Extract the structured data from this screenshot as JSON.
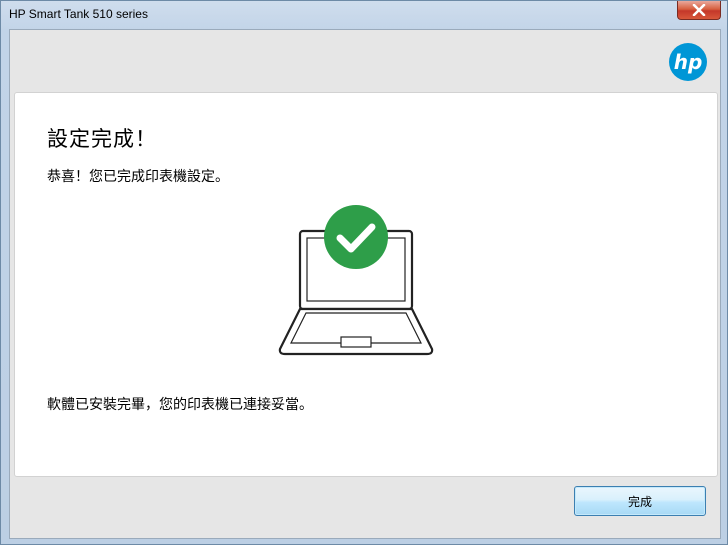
{
  "window": {
    "title": "HP Smart Tank 510 series"
  },
  "header": {
    "logo_text": "hp",
    "logo_color": "#0096d6"
  },
  "content": {
    "heading": "設定完成！",
    "subtitle": "恭喜！您已完成印表機設定。",
    "message": "軟體已安裝完畢，您的印表機已連接妥當。",
    "status_icon": "checkmark-circle-icon",
    "status_color": "#2e9e49"
  },
  "footer": {
    "finish_label": "完成"
  }
}
